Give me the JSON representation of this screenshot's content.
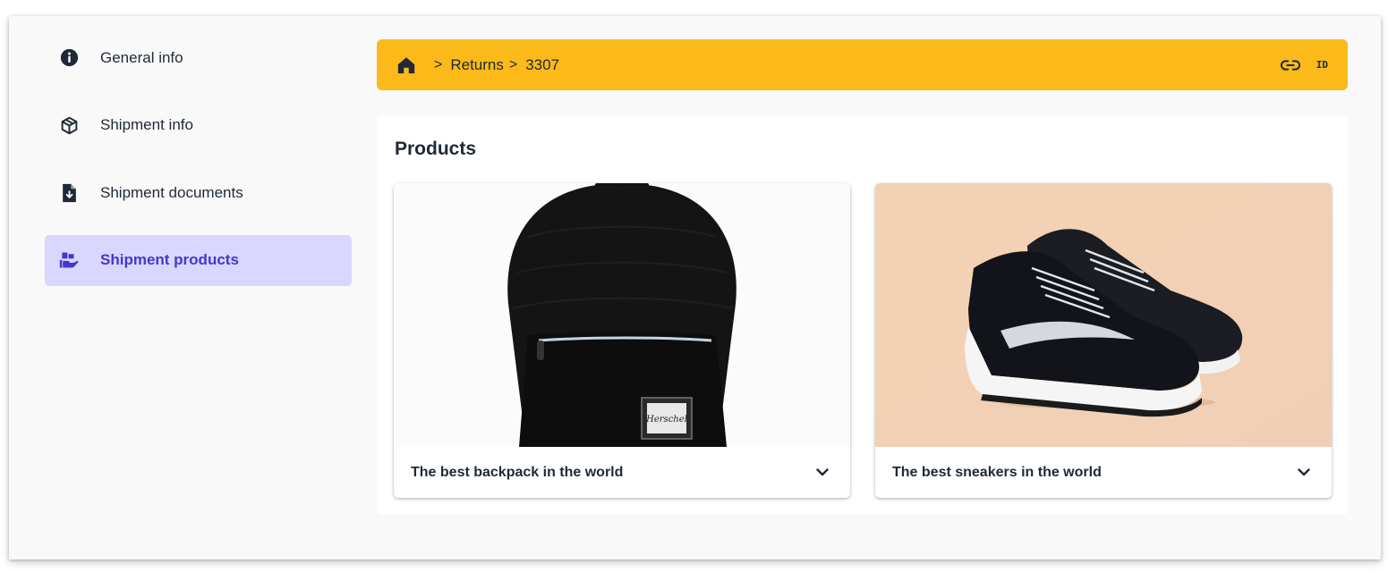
{
  "sidebar": {
    "items": [
      {
        "label": "General info",
        "icon": "info-circle-icon"
      },
      {
        "label": "Shipment info",
        "icon": "package-icon"
      },
      {
        "label": "Shipment documents",
        "icon": "file-download-icon"
      },
      {
        "label": "Shipment products",
        "icon": "hand-boxes-icon",
        "active": true
      }
    ]
  },
  "breadcrumb": {
    "home_icon": "home-icon",
    "items": [
      "Returns",
      "3307"
    ],
    "separator": ">",
    "actions": [
      {
        "icon": "link-icon"
      },
      {
        "icon": "id-icon",
        "text": "ID"
      }
    ]
  },
  "products": {
    "title": "Products",
    "cards": [
      {
        "title": "The best backpack in the world",
        "image": "backpack-image",
        "toggle_icon": "chevron-down-icon"
      },
      {
        "title": "The best sneakers in the world",
        "image": "sneakers-image",
        "toggle_icon": "chevron-down-icon"
      }
    ]
  },
  "colors": {
    "accent": "#fbba1a",
    "active_bg": "#d9d7fe",
    "active_text": "#4338ca",
    "sneaker_bg": "#f3d3b8"
  }
}
